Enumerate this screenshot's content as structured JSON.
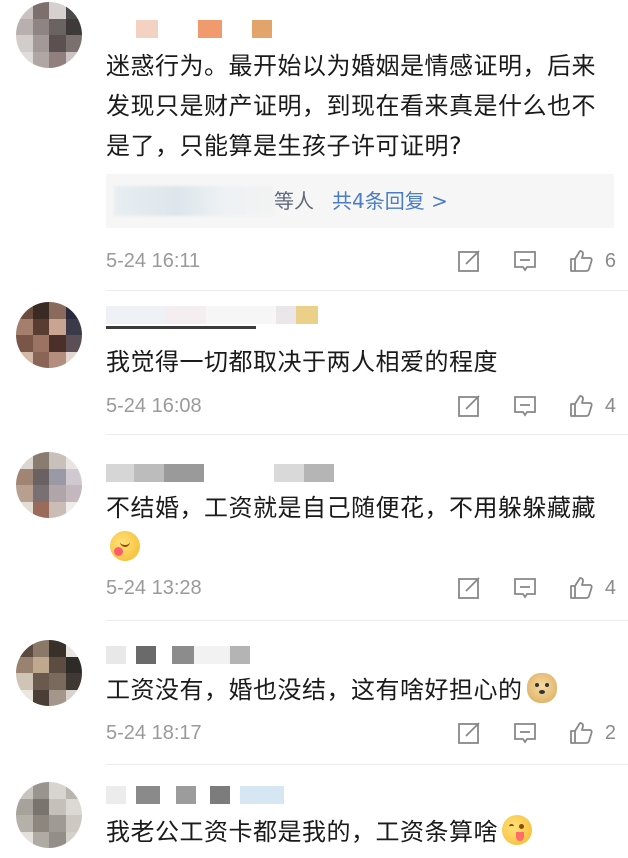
{
  "comments": [
    {
      "text": "迷惑行为。最开始以为婚姻是情感证明，后来发现只是财产证明，到现在看来真是什么也不是了，只能算是生孩子许可证明?",
      "emoji": "",
      "replies": {
        "who": "等人",
        "more": "共4条回复 >"
      },
      "time": "5-24 16:11",
      "likes": "6"
    },
    {
      "text": "我觉得一切都取决于两人相爱的程度",
      "emoji": "",
      "time": "5-24 16:08",
      "likes": "4"
    },
    {
      "text": "不结婚，工资就是自己随便花，不用躲躲藏藏",
      "emoji": "blush",
      "time": "5-24 13:28",
      "likes": "4"
    },
    {
      "text": "工资没有，婚也没结，这有啥好担心的",
      "emoji": "doge",
      "time": "5-24 18:17",
      "likes": "2"
    },
    {
      "text": "我老公工资卡都是我的，工资条算啥",
      "emoji": "tongue"
    }
  ],
  "icons": {
    "share": "share-icon",
    "comment": "comment-icon",
    "like": "thumbs-up-icon"
  }
}
